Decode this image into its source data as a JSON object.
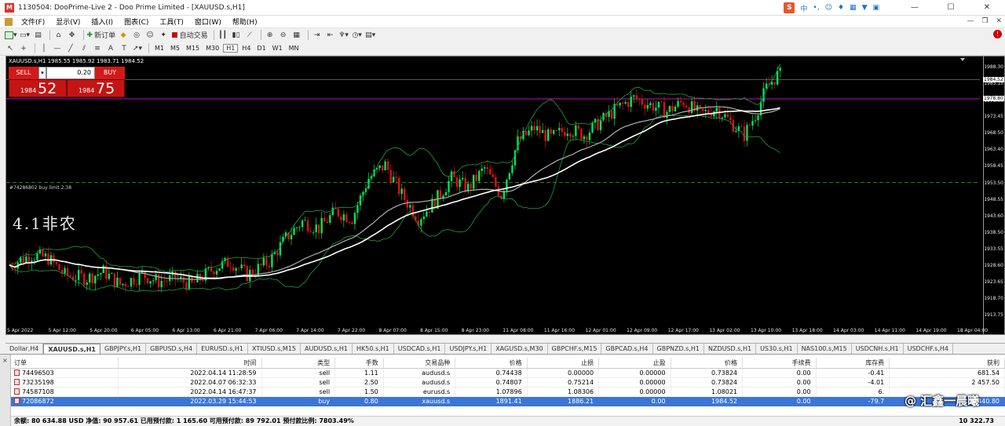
{
  "window": {
    "title": "1130504: DooPrime-Live 2 - Doo Prime Limited - [XAUUSD.s,H1]",
    "app_icon": "M"
  },
  "ime": {
    "lang": "中",
    "s": "S"
  },
  "menu": [
    "文件(F)",
    "显示(V)",
    "插入(I)",
    "图表(C)",
    "工具(T)",
    "窗口(W)",
    "帮助(H)"
  ],
  "toolbar": {
    "new_order": "新订单",
    "auto_trade": "自动交易"
  },
  "timeframes": [
    "M1",
    "M5",
    "M15",
    "M30",
    "H1",
    "H4",
    "D1",
    "W1",
    "MN"
  ],
  "chart": {
    "header": "XAUUSD.s,H1  1985.55 1985.92 1983.71 1984.52",
    "one_click": {
      "sell_label": "SELL",
      "buy_label": "BUY",
      "lot": "0.20",
      "bid_prefix": "1984",
      "bid_big": "52",
      "ask_prefix": "1984",
      "ask_big": "75"
    },
    "order_label": "#74286802 buy limit 2.38",
    "annotation": "4.1非农",
    "price_labels": [
      "1988.30",
      "1983.15",
      "1978.00",
      "1973.45",
      "1968.50",
      "1963.40",
      "1958.45",
      "1953.50",
      "1948.55",
      "1943.60",
      "1938.50",
      "1933.55",
      "1928.60",
      "1923.65",
      "1918.70",
      "1913.75"
    ],
    "price_box_bid": "1984.52",
    "price_box_line": "1978.80",
    "time_labels": [
      "5 Apr 2022",
      "5 Apr 12:00",
      "5 Apr 20:00",
      "6 Apr 05:00",
      "6 Apr 13:00",
      "6 Apr 21:00",
      "7 Apr 06:00",
      "7 Apr 14:00",
      "7 Apr 22:00",
      "8 Apr 07:00",
      "8 Apr 15:00",
      "8 Apr 23:00",
      "11 Apr 08:00",
      "11 Apr 16:00",
      "12 Apr 01:00",
      "12 Apr 09:00",
      "12 Apr 17:00",
      "13 Apr 02:00",
      "13 Apr 10:00",
      "13 Apr 18:00",
      "14 Apr 03:00",
      "14 Apr 11:00",
      "14 Apr 19:00",
      "18 Apr 04:00"
    ],
    "colors": {
      "bull": "#00e45c",
      "bear": "#e01010",
      "band": "#1fa03a",
      "ma": "#ffffff",
      "ma2": "#b0b0b0",
      "magenta": "#c010c0",
      "dash": "#2a8a2a"
    }
  },
  "chart_data": {
    "type": "candlestick",
    "symbol": "XAUUSD.s",
    "timeframe": "H1",
    "ohlc_last": {
      "open": 1985.55,
      "high": 1985.92,
      "low": 1983.71,
      "close": 1984.52
    },
    "ylim": [
      1911.5,
      1991.5
    ],
    "y_ticks": [
      1988.3,
      1983.15,
      1978.0,
      1973.45,
      1968.5,
      1963.4,
      1958.45,
      1953.5,
      1948.55,
      1943.6,
      1938.5,
      1933.55,
      1928.6,
      1923.65,
      1918.7,
      1913.75
    ],
    "x_labels": [
      "5 Apr 2022",
      "5 Apr 12:00",
      "5 Apr 20:00",
      "6 Apr 05:00",
      "6 Apr 13:00",
      "6 Apr 21:00",
      "7 Apr 06:00",
      "7 Apr 14:00",
      "7 Apr 22:00",
      "8 Apr 07:00",
      "8 Apr 15:00",
      "8 Apr 23:00",
      "11 Apr 08:00",
      "11 Apr 16:00",
      "12 Apr 01:00",
      "12 Apr 09:00",
      "12 Apr 17:00",
      "13 Apr 02:00",
      "13 Apr 10:00",
      "13 Apr 18:00",
      "14 Apr 03:00",
      "14 Apr 11:00",
      "14 Apr 19:00",
      "18 Apr 04:00"
    ],
    "trend_path": [
      [
        0,
        1929
      ],
      [
        8,
        1932
      ],
      [
        14,
        1931
      ],
      [
        20,
        1926
      ],
      [
        28,
        1925
      ],
      [
        34,
        1927
      ],
      [
        40,
        1923
      ],
      [
        48,
        1926
      ],
      [
        54,
        1924
      ],
      [
        60,
        1925
      ],
      [
        66,
        1923
      ],
      [
        74,
        1928
      ],
      [
        80,
        1930
      ],
      [
        86,
        1926
      ],
      [
        94,
        1930
      ],
      [
        100,
        1937
      ],
      [
        106,
        1942
      ],
      [
        112,
        1940
      ],
      [
        118,
        1945
      ],
      [
        124,
        1943
      ],
      [
        130,
        1955
      ],
      [
        136,
        1959
      ],
      [
        142,
        1950
      ],
      [
        148,
        1943
      ],
      [
        154,
        1948
      ],
      [
        160,
        1955
      ],
      [
        166,
        1952
      ],
      [
        172,
        1958
      ],
      [
        178,
        1950
      ],
      [
        184,
        1966
      ],
      [
        190,
        1970
      ],
      [
        196,
        1967
      ],
      [
        202,
        1970
      ],
      [
        208,
        1968
      ],
      [
        214,
        1972
      ],
      [
        220,
        1976
      ],
      [
        226,
        1979
      ],
      [
        232,
        1977
      ],
      [
        238,
        1975
      ],
      [
        244,
        1978
      ],
      [
        250,
        1974
      ],
      [
        256,
        1976
      ],
      [
        262,
        1971
      ],
      [
        266,
        1968
      ],
      [
        270,
        1974
      ],
      [
        274,
        1982
      ],
      [
        278,
        1986
      ]
    ],
    "current_price": 1984.52,
    "horizontal_lines": [
      {
        "price": 1978.8,
        "style": "solid-magenta"
      },
      {
        "price": 1953.7,
        "style": "dashed",
        "label": "#74286802 buy limit 2.38"
      }
    ]
  },
  "tabs": [
    "Dollar,H4",
    "XAUUSD.s,H1",
    "GBPJPY.s,H1",
    "GBPUSD.s,H4",
    "EURUSD.s,H1",
    "XTIUSD.s,M15",
    "AUDUSD.s,H1",
    "HK50.s,H1",
    "USDCAD.s,H1",
    "USDJPY.s,H1",
    "XAGUSD.s,M30",
    "GBPCHF.s,M15",
    "GBPCAD.s,H4",
    "GBPNZD.s,H1",
    "NZDUSD.s,H1",
    "US30.s,H1",
    "NAS100.s,M15",
    "USDCNH.s,H1",
    "USDCHF.s,H4"
  ],
  "active_tab": 1,
  "terminal": {
    "close": "×",
    "columns": [
      "订单",
      "时间",
      "类型",
      "手数",
      "交易品种",
      "价格",
      "止损",
      "止盈",
      "价格",
      "手续费",
      "库存费",
      "获利"
    ],
    "rows": [
      [
        "74496503",
        "2022.04.14 11:28:59",
        "sell",
        "1.11",
        "audusd.s",
        "0.74438",
        "0.00000",
        "0.00000",
        "0.73824",
        "0.00",
        "-0.41",
        "681.54"
      ],
      [
        "73235198",
        "2022.04.07 06:32:33",
        "sell",
        "2.50",
        "audusd.s",
        "0.74807",
        "0.75214",
        "0.00000",
        "0.73824",
        "0.00",
        "-4.01",
        "2 457.50"
      ],
      [
        "74587108",
        "2022.04.14 16:47:37",
        "sell",
        "1.50",
        "eurusd.s",
        "1.07896",
        "1.08306",
        "0.00000",
        "1.08021",
        "0.00",
        "6.",
        ""
      ],
      [
        "72086872",
        "2022.03.29 15:44:53",
        "buy",
        "0.80",
        "xauusd.s",
        "1891.41",
        "1886.21",
        "0.00",
        "1984.52",
        "0.00",
        "-79.7",
        "7 440.80"
      ]
    ],
    "selected_row": 3,
    "summary": "余额: 80 634.88 USD  净值: 90 957.61  已用预付款: 1 165.60  可用预付款: 89 792.01  预付款比例: 7803.49%",
    "summary_total": "10 322.73"
  },
  "watermark": "@ 汇鑫一晨曦"
}
